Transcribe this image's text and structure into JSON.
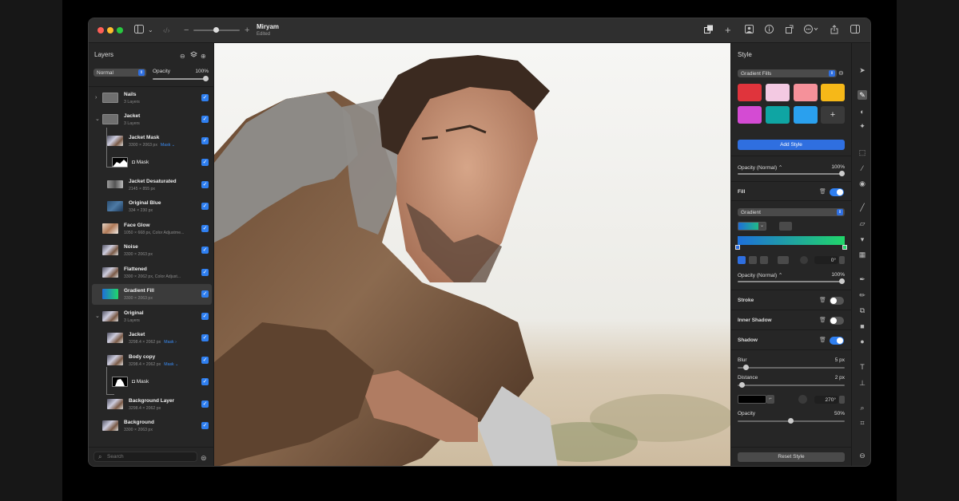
{
  "window": {
    "title": "Miryam",
    "subtitle": "Edited"
  },
  "layers_panel": {
    "title": "Layers",
    "blend_mode": "Normal",
    "opacity_label": "Opacity",
    "opacity_value": "100%",
    "search_placeholder": "Search",
    "layers": [
      {
        "name": "Nails",
        "info": "3 Layers"
      },
      {
        "name": "Jacket",
        "info": "3 Layers"
      },
      {
        "name": "Jacket Mask",
        "info": "3300 × 2063 px",
        "mask": "Mask ⌄"
      },
      {
        "name": "Mask",
        "info": ""
      },
      {
        "name": "Jacket Desaturated",
        "info": "2145 × 855 px"
      },
      {
        "name": "Original Blue",
        "info": "334 × 230 px"
      },
      {
        "name": "Face Glow",
        "info": "1050 × 668 px, Color Adjustme..."
      },
      {
        "name": "Noise",
        "info": "3300 × 2063 px"
      },
      {
        "name": "Flattened",
        "info": "3300 × 2062 px, Color Adjust..."
      },
      {
        "name": "Gradient Fill",
        "info": "3300 × 2063 px"
      },
      {
        "name": "Original",
        "info": "3 Layers"
      },
      {
        "name": "Jacket",
        "info": "3298.4 × 2062 px",
        "mask": "Mask ›"
      },
      {
        "name": "Body copy",
        "info": "3298.4 × 2062 px",
        "mask": "Mask ⌄"
      },
      {
        "name": "Mask",
        "info": ""
      },
      {
        "name": "Background Layer",
        "info": "3298.4 × 2062 px"
      },
      {
        "name": "Background",
        "info": "3300 × 2063 px"
      }
    ]
  },
  "style_panel": {
    "title": "Style",
    "preset_select": "Gradient Fills",
    "add_style": "Add Style",
    "opacity_label": "Opacity (Normal) ⌃",
    "opacity_value": "100%",
    "fill_label": "Fill",
    "fill_type": "Gradient",
    "gradient_angle": "0°",
    "fill_opacity_label": "Opacity (Normal) ⌃",
    "fill_opacity_value": "100%",
    "stroke_label": "Stroke",
    "inner_shadow_label": "Inner Shadow",
    "shadow_label": "Shadow",
    "blur_label": "Blur",
    "blur_value": "5 px",
    "distance_label": "Distance",
    "distance_value": "2 px",
    "shadow_angle": "270°",
    "shadow_opacity_label": "Opacity",
    "shadow_opacity_value": "50%",
    "reset_style": "Reset Style",
    "swatches": [
      "#e0343c",
      "#f3c9e2",
      "#f5919a",
      "#f6b818",
      "#d44bd3",
      "#0fa5a3",
      "#2aa0ee"
    ],
    "fill_enabled": true,
    "stroke_enabled": false,
    "inner_shadow_enabled": false,
    "shadow_enabled": true
  },
  "colors": {
    "accent": "#2f7ff0",
    "gradient_start": "#1e6fd9",
    "gradient_end": "#21d66a"
  }
}
